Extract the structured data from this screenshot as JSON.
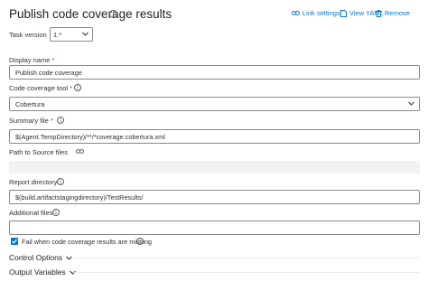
{
  "header": {
    "title": "Publish code coverage results",
    "actions": {
      "link_settings": "Link settings",
      "view_yaml": "View YAML",
      "remove": "Remove"
    }
  },
  "task_version": {
    "label": "Task version",
    "value": "1.*"
  },
  "fields": {
    "display_name": {
      "label": "Display name",
      "required_mark": "*",
      "value": "Publish code coverage"
    },
    "code_coverage_tool": {
      "label": "Code coverage tool",
      "required_mark": "*",
      "value": "Cobertura"
    },
    "summary_file": {
      "label": "Summary file",
      "required_mark": "*",
      "value": "$(Agent.TempDirectory)/**/*coverage.cobertura.xml"
    },
    "path_to_source": {
      "label": "Path to Source files",
      "value": ""
    },
    "report_directory": {
      "label": "Report directory",
      "value": "$(build.artifactstagingdirectory)/TestResults/"
    },
    "additional_files": {
      "label": "Additional files",
      "value": ""
    }
  },
  "fail_checkbox": {
    "label": "Fail when code coverage results are missing",
    "checked": true
  },
  "sections": {
    "control_options": "Control Options",
    "output_variables": "Output Variables"
  },
  "icons": {
    "info": "i"
  },
  "colors": {
    "accent": "#0078d4",
    "required": "#a4262c"
  }
}
